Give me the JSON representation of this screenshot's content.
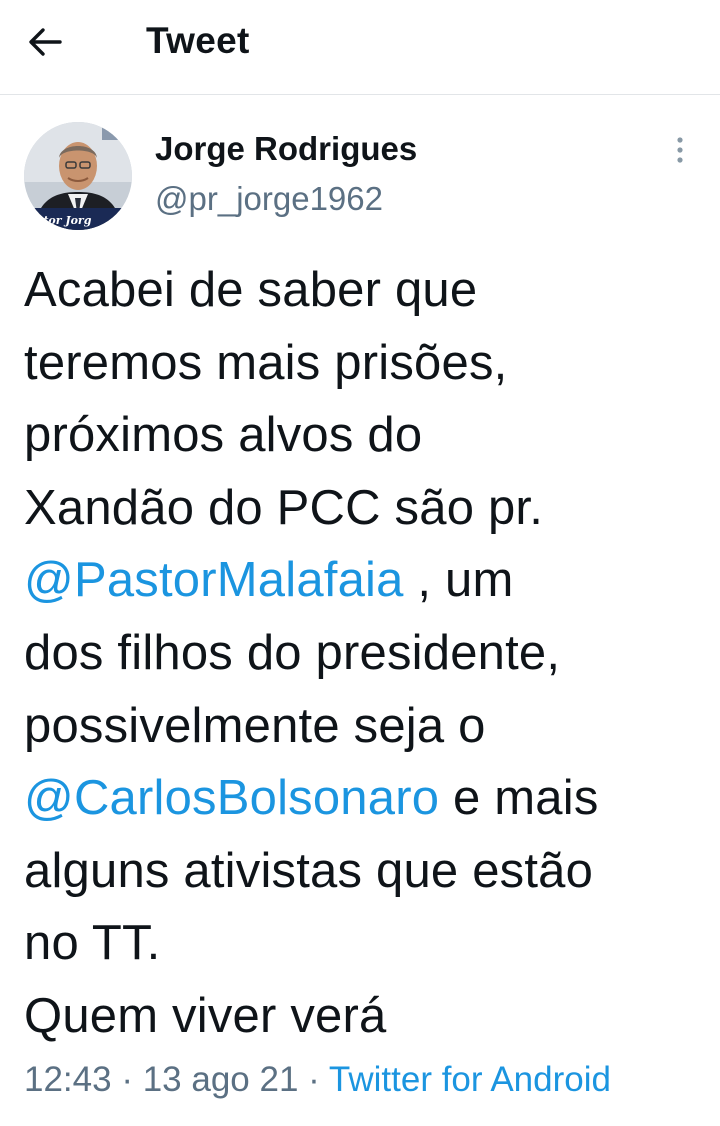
{
  "header": {
    "title": "Tweet",
    "back_icon": "arrow-left-icon"
  },
  "author": {
    "name": "Jorge Rodrigues",
    "handle": "@pr_jorge1962",
    "avatar_caption": "astor Jorg"
  },
  "tweet": {
    "lines": [
      {
        "text": "Acabei de saber que"
      },
      {
        "text": "teremos mais prisões,"
      },
      {
        "text": "próximos alvos do"
      },
      {
        "text": "Xandão do PCC são pr."
      },
      {
        "mention": "@PastorMalafaia",
        "after": " , um"
      },
      {
        "text": "dos filhos do presidente,"
      },
      {
        "text": "possivelmente seja o"
      },
      {
        "mention": "@CarlosBolsonaro",
        "after": " e mais"
      },
      {
        "text": "alguns ativistas que estão"
      },
      {
        "text": "no TT."
      },
      {
        "text": "Quem viver verá"
      }
    ]
  },
  "meta": {
    "time": "12:43",
    "sep1": " · ",
    "date": "13 ago 21",
    "sep2": " · ",
    "source": "Twitter for Android"
  },
  "colors": {
    "text": "#0f1419",
    "secondary": "#5b7083",
    "link": "#1b95e0",
    "divider": "#e2e5e8"
  }
}
